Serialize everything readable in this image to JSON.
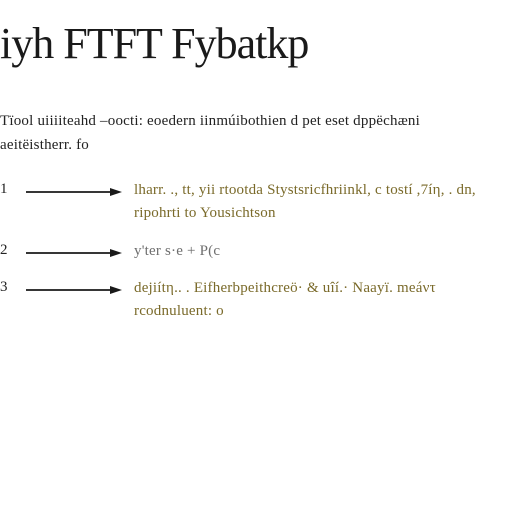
{
  "title": "iyh FTFT Fybatkp",
  "intro": "Tïool  uiiiiteahd  –oocti:   eoedern  iinmúibothien  d pet\neset    dppëchæni  aeitëistherr. fo",
  "steps": [
    {
      "num": "1",
      "body": "lharr. .,   tt,  yii   rtootda   Stystsricfhriinkl,  c\ntostí ,7íη,    .  dn,   ripohrti   to  Yousichtson"
    },
    {
      "num": "2",
      "body": "y'ter  s·e                                                  + P(c"
    },
    {
      "num": "3",
      "body": "dejiítη.. .             Eifherbpeithcreö·   &   uîí.·\nNaayï.  meáντ  rcodnuluent: o"
    }
  ]
}
